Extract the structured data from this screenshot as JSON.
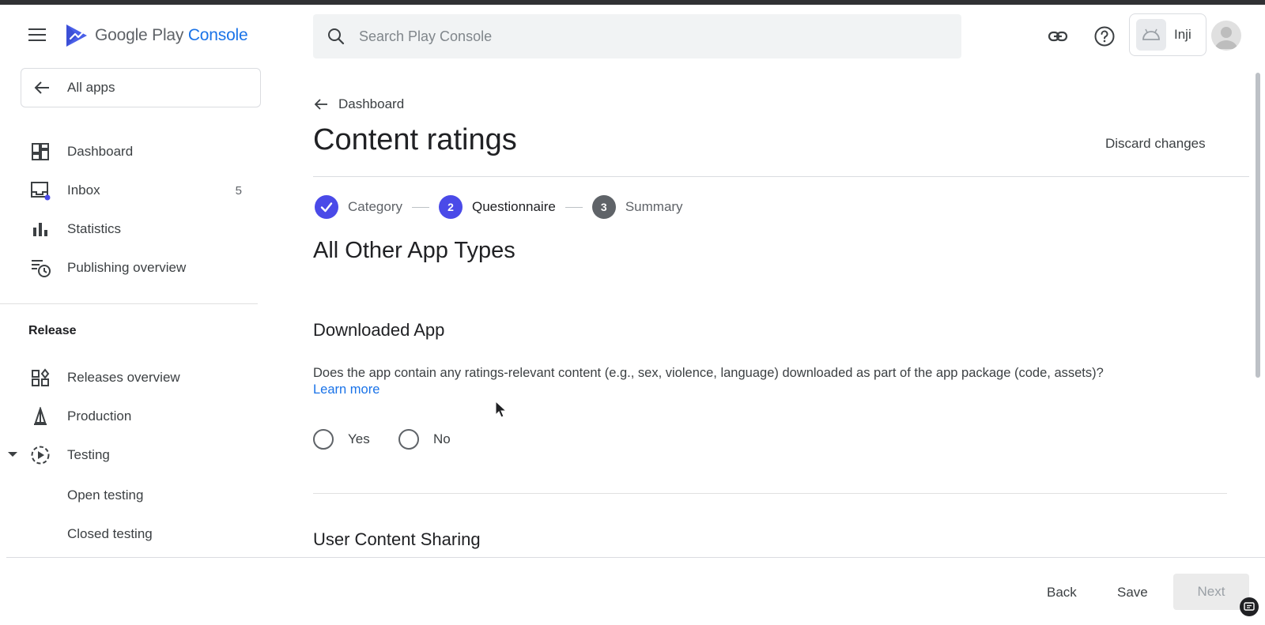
{
  "header": {
    "logo_main": "Google Play ",
    "logo_accent": "Console",
    "search_placeholder": "Search Play Console",
    "app_name": "Inji"
  },
  "sidebar": {
    "all_apps": "All apps",
    "items": [
      {
        "label": "Dashboard",
        "icon": "dashboard-icon"
      },
      {
        "label": "Inbox",
        "icon": "inbox-icon",
        "badge": "5"
      },
      {
        "label": "Statistics",
        "icon": "bar-chart-icon"
      },
      {
        "label": "Publishing overview",
        "icon": "publishing-icon"
      }
    ],
    "section_release": "Release",
    "release_items": [
      {
        "label": "Releases overview",
        "icon": "releases-icon"
      },
      {
        "label": "Production",
        "icon": "production-icon"
      },
      {
        "label": "Testing",
        "icon": "testing-icon"
      }
    ],
    "testing_sub": [
      "Open testing",
      "Closed testing"
    ]
  },
  "main": {
    "breadcrumb": "Dashboard",
    "title": "Content ratings",
    "discard": "Discard changes",
    "steps": [
      {
        "num": "",
        "label": "Category",
        "state": "done"
      },
      {
        "num": "2",
        "label": "Questionnaire",
        "state": "active"
      },
      {
        "num": "3",
        "label": "Summary",
        "state": "pending"
      }
    ],
    "section_title": "All Other App Types",
    "question1": {
      "heading": "Downloaded App",
      "text": "Does the app contain any ratings-relevant content (e.g., sex, violence, language) downloaded as part of the app package (code, assets)?",
      "link": "Learn more",
      "options": [
        "Yes",
        "No"
      ]
    },
    "question2": {
      "heading": "User Content Sharing"
    }
  },
  "footer": {
    "back": "Back",
    "save": "Save",
    "next": "Next"
  },
  "colors": {
    "accent": "#1a73e8",
    "step_active": "#4a4ae8",
    "step_pending": "#5f6368"
  }
}
